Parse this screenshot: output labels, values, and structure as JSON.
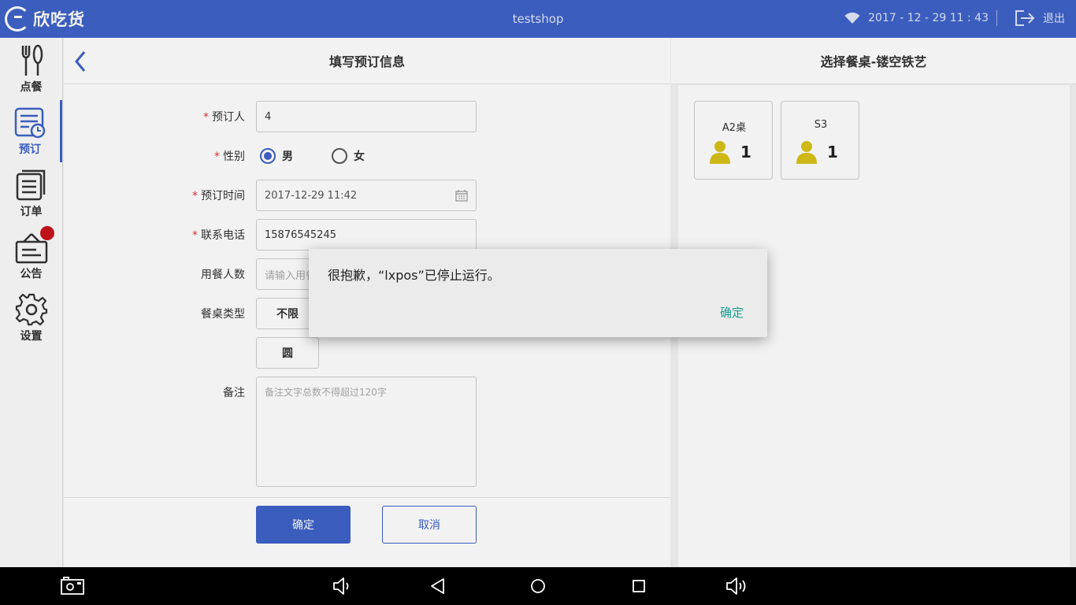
{
  "topbar": {
    "logo_text": "欣吃货",
    "shop_name": "testshop",
    "datetime": "2017 - 12 - 29   11 : 43",
    "logout_label": "退出"
  },
  "sidebar": {
    "items": [
      {
        "label": "点餐",
        "icon": "fork-spoon-icon"
      },
      {
        "label": "预订",
        "icon": "reservation-icon"
      },
      {
        "label": "订单",
        "icon": "orders-icon"
      },
      {
        "label": "公告",
        "icon": "notice-icon"
      },
      {
        "label": "设置",
        "icon": "gear-icon"
      }
    ],
    "active": "预订"
  },
  "form": {
    "header": "填写预订信息",
    "booker_label": "预订人",
    "booker_value": "4",
    "gender_label": "性别",
    "gender_male": "男",
    "gender_female": "女",
    "time_label": "预订时间",
    "time_value": "2017-12-29 11:42",
    "phone_label": "联系电话",
    "phone_value": "15876545245",
    "diners_label": "用餐人数",
    "diners_placeholder": "请输入用餐",
    "table_type_label": "餐桌类型",
    "table_type_options": [
      "不限",
      "圆"
    ],
    "remark_label": "备注",
    "remark_placeholder": "备注文字总数不得超过120字",
    "confirm_label": "确定",
    "cancel_label": "取消",
    "required_mark": "*"
  },
  "tables": {
    "header": "选择餐桌-镂空铁艺",
    "items": [
      {
        "name": "A2桌",
        "count": "1"
      },
      {
        "name": "S3",
        "count": "1"
      }
    ]
  },
  "dialog": {
    "message": "很抱歉，“lxpos”已停止运行。",
    "ok_label": "确定"
  },
  "colors": {
    "brand": "#3f63c9",
    "dialog_button": "#1a9c8f",
    "required": "#d33333",
    "badge": "#c8131b",
    "person_icon": "#d9c21a"
  }
}
